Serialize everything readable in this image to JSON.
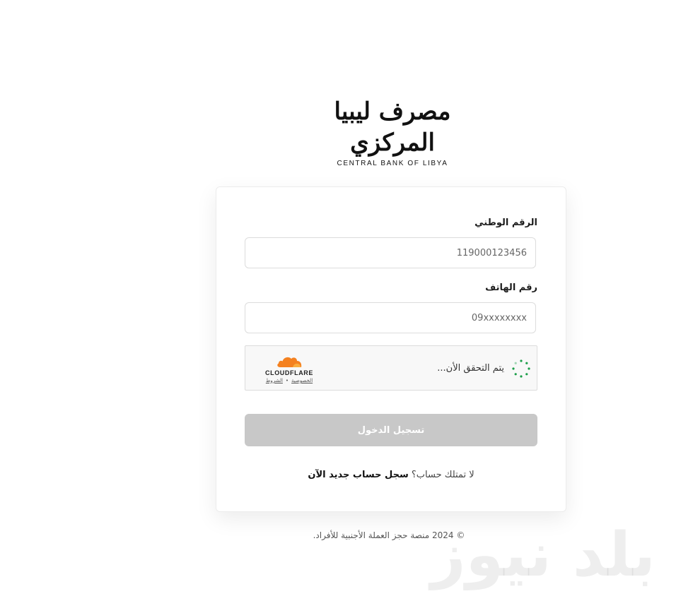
{
  "logo": {
    "arabic_name": "مصرف ليبيا المركزي",
    "english_name": "CENTRAL BANK OF LIBYA"
  },
  "form": {
    "national_id_label": "الرقم الوطني",
    "national_id_placeholder": "119000123456",
    "phone_label": "رقم الهاتف",
    "phone_placeholder": "09xxxxxxxx",
    "captcha_status": "يتم التحقق الأن...",
    "captcha_brand": "CLOUDFLARE",
    "captcha_privacy": "الخصوصية",
    "captcha_terms": "الشروط",
    "submit_label": "تسجيل الدخول",
    "no_account_text": "لا تمتلك حساب؟",
    "signup_link": "سجل حساب جديد الآن"
  },
  "footer": {
    "copyright": "© 2024 منصة حجز العملة الأجنبية للأفراد."
  },
  "watermark": {
    "text": "بلد نيوز"
  },
  "colors": {
    "button_disabled": "#c8c8c8",
    "cloudflare_orange": "#f48120",
    "spinner_green": "#1a9e48"
  }
}
